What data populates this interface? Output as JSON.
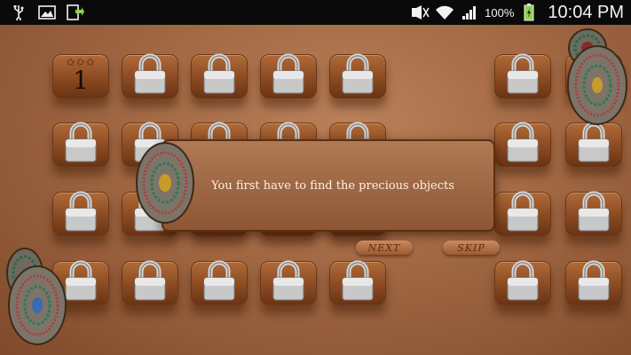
{
  "status_bar": {
    "left_icons": [
      "usb-icon",
      "image-icon",
      "download-icon"
    ],
    "right_icons": [
      "nfc-mute-icon",
      "wifi-icon",
      "signal-icon",
      "battery-icon"
    ],
    "battery_percent": "100%",
    "time": "10:04 PM"
  },
  "level_tile": {
    "stars": "✩✩✩",
    "number": "1"
  },
  "dialog": {
    "message": "You first have to find the precious objects"
  },
  "buttons": {
    "next_label": "NEXT",
    "skip_label": "SKIP"
  },
  "colors": {
    "board": "#a46a45",
    "tile": "#8a4a22",
    "dialog": "#9c6440"
  }
}
